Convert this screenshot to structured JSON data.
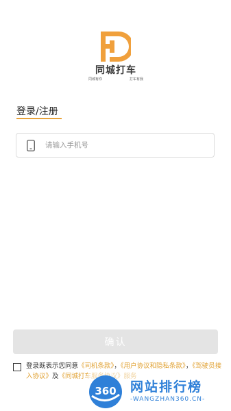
{
  "logo": {
    "name": "同城打车",
    "slogan_left": "同城有你",
    "slogan_right": "打车有我",
    "brand_color": "#f0a03c",
    "icon": "fd-logo-icon"
  },
  "login": {
    "heading": "登录/注册",
    "accent_color": "#e8a23a"
  },
  "phone": {
    "icon": "phone-icon",
    "placeholder": "请输入手机号",
    "value": ""
  },
  "confirm": {
    "label": "确认",
    "state": "disabled"
  },
  "agreement": {
    "checked": false,
    "prefix": "登录既表示您同意",
    "link_driver_terms": "《司机条款》",
    "sep1": "，",
    "link_user_privacy": "《用户协议和隐私条款》",
    "sep2": "，",
    "link_driver_join": "《驾驶员接入协议》",
    "and": "及",
    "link_service": "《同城打车服务协议》",
    "tail": "服务"
  },
  "watermark": {
    "badge": "360",
    "title": "网站排行榜",
    "url": "-WANGZHAN360.CN-",
    "color": "#2f80d8"
  }
}
